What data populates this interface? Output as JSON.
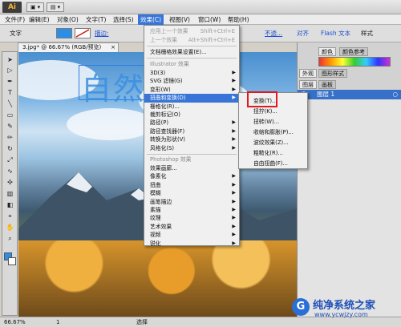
{
  "app": {
    "logo": "Ai",
    "title_buttons": [
      "▣ ▾",
      "▤ ▾"
    ]
  },
  "menubar": {
    "items": [
      "文件(F)",
      "编辑(E)",
      "对象(O)",
      "文字(T)",
      "选择(S)",
      "效果(C)",
      "视图(V)",
      "窗口(W)",
      "帮助(H)"
    ],
    "active_index": 5
  },
  "controlbar": {
    "label_text": "文字",
    "stroke_label": "描边:",
    "not_safe": "不透...",
    "align": "对齐",
    "flash": "Flash 文本",
    "styles": "样式"
  },
  "document": {
    "tab_title": "3.jpg* @ 66.67% (RGB/预览)",
    "close": "×"
  },
  "artwork": {
    "text": "自然"
  },
  "effect_menu": {
    "apply_last": {
      "label": "应用上一个效果",
      "shortcut": "Shift+Ctrl+E"
    },
    "last_effect": {
      "label": "上一个效果",
      "shortcut": "Alt+Shift+Ctrl+E"
    },
    "raster_settings": "文档栅格效果设置(E)...",
    "illustrator_header": "Illustrator 效果",
    "illustrator_items": [
      "3D(3)",
      "SVG 滤镜(G)",
      "变形(W)",
      "扭曲和变换(D)",
      "栅格化(R)...",
      "裁剪标记(O)",
      "路径(P)",
      "路径查找器(F)",
      "转换为形状(V)",
      "风格化(S)"
    ],
    "highlighted": "扭曲和变换(D)",
    "photoshop_header": "Photoshop 效果",
    "photoshop_items": [
      "效果画廊...",
      "像素化",
      "扭曲",
      "模糊",
      "画笔描边",
      "素描",
      "纹理",
      "艺术效果",
      "视频",
      "锐化",
      "风格化"
    ]
  },
  "sub_menu": {
    "items": [
      "变换(T)...",
      "扭拧(K)...",
      "扭转(W)...",
      "收缩和膨胀(P)...",
      "波纹效果(Z)...",
      "粗糙化(R)...",
      "自由扭曲(F)..."
    ]
  },
  "right_panel": {
    "tabs_top": [
      "颜色",
      "颜色参考"
    ],
    "tabs_mid": [
      "外观",
      "图形样式"
    ],
    "tabs_layers": [
      "图层",
      "画板"
    ],
    "layer_name": "图层 1"
  },
  "statusbar": {
    "zoom": "66.67%",
    "page": "1",
    "mode": "选择"
  },
  "watermark": {
    "logo": "G",
    "name": "纯净系统之家",
    "url": "www.ycwjzy.com"
  },
  "colors": {
    "accent": "#3875d7",
    "highlight_box": "#e0181f"
  },
  "icons": [
    "selection-tool-icon",
    "direct-select-icon",
    "pen-tool-icon",
    "type-tool-icon",
    "line-tool-icon",
    "rectangle-tool-icon",
    "brush-tool-icon",
    "pencil-tool-icon",
    "rotate-tool-icon",
    "scale-tool-icon",
    "warp-tool-icon",
    "symbol-tool-icon",
    "graph-tool-icon",
    "gradient-tool-icon",
    "eyedropper-tool-icon",
    "hand-tool-icon",
    "zoom-tool-icon"
  ]
}
